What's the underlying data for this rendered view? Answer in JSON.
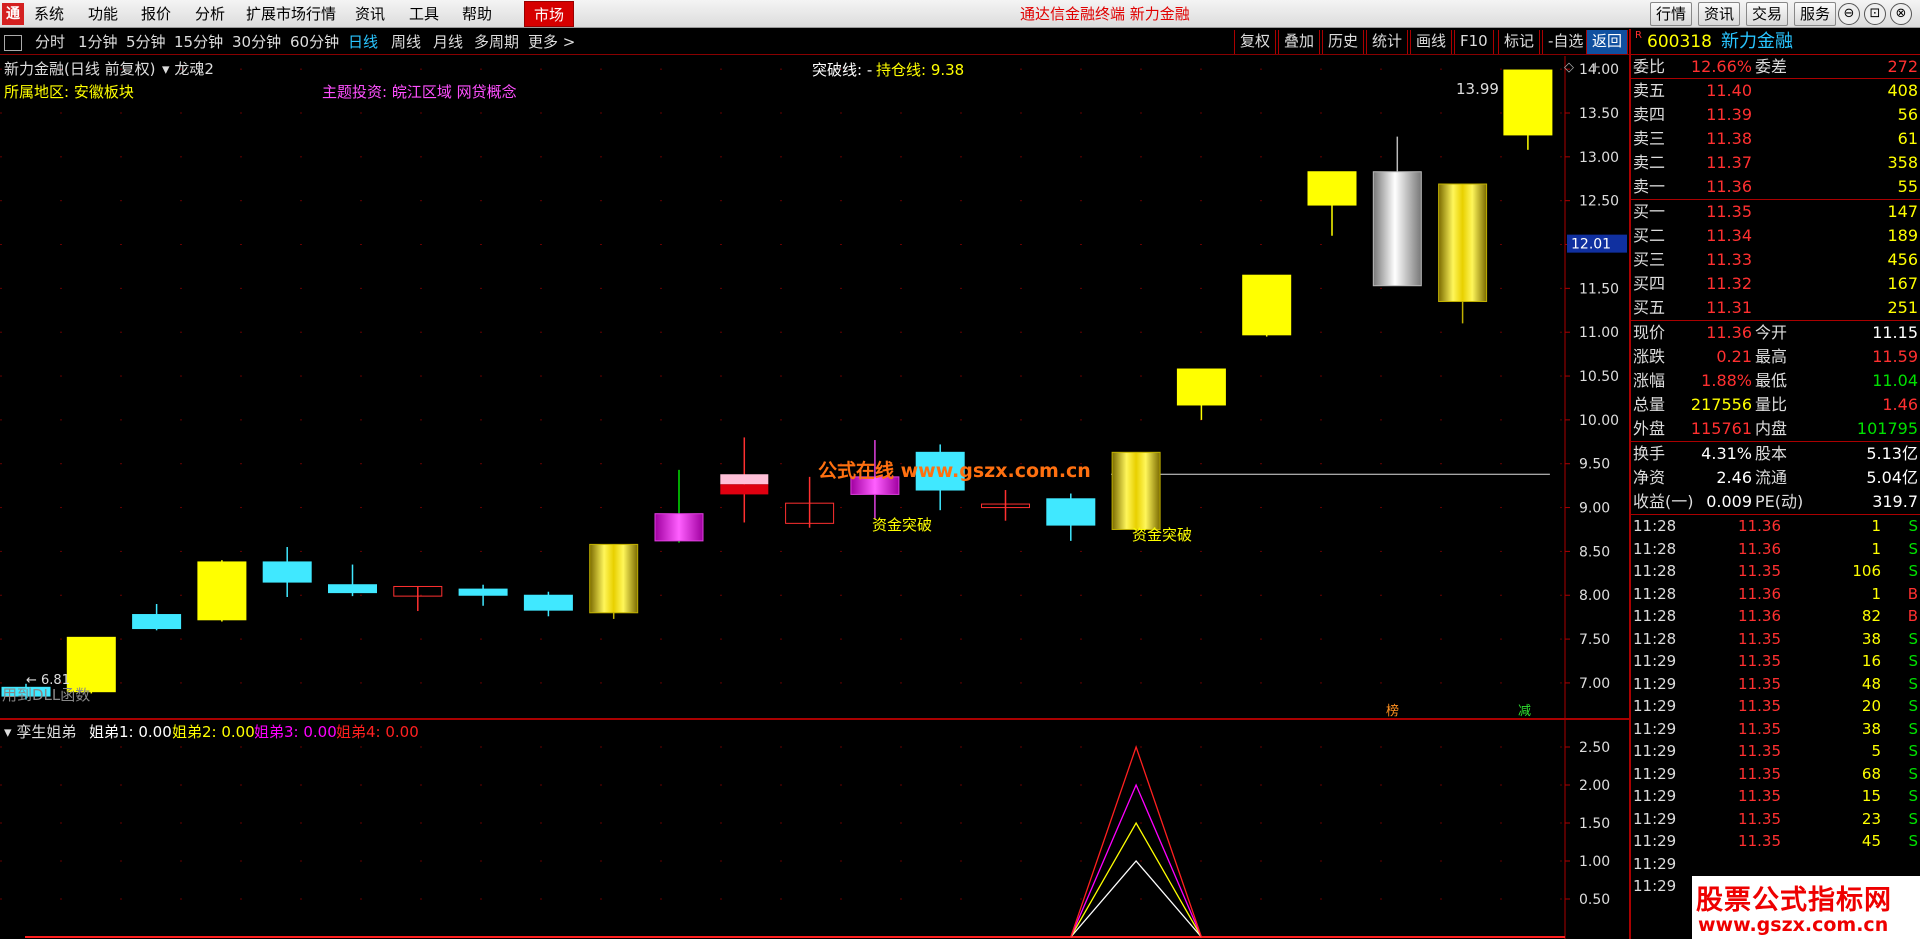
{
  "menubar": {
    "logo": "通",
    "items": [
      "系统",
      "功能",
      "报价",
      "分析",
      "扩展市场行情",
      "资讯",
      "工具",
      "帮助"
    ],
    "market_button": "市场",
    "center_title": "通达信金融终端  新力金融",
    "right_buttons": [
      "行情",
      "资讯",
      "交易",
      "服务"
    ],
    "window_controls": [
      "⊖",
      "⊡",
      "⊗"
    ]
  },
  "toolbar": {
    "periods": [
      "分时",
      "1分钟",
      "5分钟",
      "15分钟",
      "30分钟",
      "60分钟",
      "日线",
      "周线",
      "月线",
      "多周期",
      "更多 >"
    ],
    "active_period": "日线",
    "tools": [
      "复权",
      "叠加",
      "历史",
      "统计",
      "画线",
      "F10",
      "标记",
      "-自选",
      "返回"
    ]
  },
  "main_chart": {
    "title": "新力金融(日线 前复权)",
    "indicator": "龙魂2",
    "region_label": "所属地区: 安徽板块",
    "theme_label": "主题投资: 皖江区域 网贷概念",
    "breakout_label": "突破线: -",
    "hold_label": "持仓线: 9.38",
    "high_label": "13.99",
    "low_label": "← 6.81",
    "dll_label": "用到DLL函数",
    "watermark": "公式在线  www.gszx.com.cn",
    "price_tag": "12.01",
    "signal_labels": [
      "资金突破",
      "资金突破"
    ],
    "badges": [
      "榜",
      "减"
    ],
    "axis": [
      "14.00",
      "13.50",
      "13.00",
      "12.50",
      "12.00",
      "11.50",
      "11.00",
      "10.50",
      "10.00",
      "9.50",
      "9.00",
      "8.50",
      "8.00",
      "7.50",
      "7.00"
    ]
  },
  "chart_data": {
    "type": "candlestick",
    "ylim": [
      6.6,
      14.15
    ],
    "hold_line": 9.38,
    "candles": [
      {
        "o": 6.95,
        "c": 6.85,
        "h": 6.99,
        "l": 6.81,
        "color": "cyan"
      },
      {
        "o": 6.9,
        "c": 7.52,
        "h": 7.52,
        "l": 6.88,
        "color": "yellow"
      },
      {
        "o": 7.62,
        "c": 7.78,
        "h": 7.9,
        "l": 7.6,
        "color": "cyan"
      },
      {
        "o": 7.72,
        "c": 8.38,
        "h": 8.4,
        "l": 7.7,
        "color": "yellow"
      },
      {
        "o": 8.15,
        "c": 8.38,
        "h": 8.55,
        "l": 7.98,
        "color": "cyan"
      },
      {
        "o": 8.03,
        "c": 8.12,
        "h": 8.35,
        "l": 7.99,
        "color": "cyan"
      },
      {
        "o": 8.1,
        "c": 7.99,
        "h": 8.1,
        "l": 7.82,
        "color": "red-hollow"
      },
      {
        "o": 8.0,
        "c": 8.07,
        "h": 8.12,
        "l": 7.88,
        "color": "cyan"
      },
      {
        "o": 7.83,
        "c": 8.0,
        "h": 8.04,
        "l": 7.76,
        "color": "cyan"
      },
      {
        "o": 7.8,
        "c": 8.58,
        "h": 8.58,
        "l": 7.73,
        "color": "gold-stripe"
      },
      {
        "o": 8.62,
        "c": 8.93,
        "h": 9.43,
        "l": 8.6,
        "color": "magenta"
      },
      {
        "o": 9.15,
        "c": 9.38,
        "h": 9.8,
        "l": 8.83,
        "color": "pink-red"
      },
      {
        "o": 9.05,
        "c": 8.82,
        "h": 9.35,
        "l": 8.77,
        "color": "red-hollow"
      },
      {
        "o": 9.15,
        "c": 9.35,
        "h": 9.77,
        "l": 8.87,
        "color": "magenta"
      },
      {
        "o": 9.2,
        "c": 9.63,
        "h": 9.72,
        "l": 8.97,
        "color": "cyan"
      },
      {
        "o": 9.04,
        "c": 9.0,
        "h": 9.2,
        "l": 8.85,
        "color": "red-hollow"
      },
      {
        "o": 8.8,
        "c": 9.1,
        "h": 9.16,
        "l": 8.62,
        "color": "cyan"
      },
      {
        "o": 8.75,
        "c": 9.63,
        "h": 9.63,
        "l": 8.72,
        "color": "gold-stripe"
      },
      {
        "o": 10.17,
        "c": 10.58,
        "h": 10.58,
        "l": 10.0,
        "color": "yellow"
      },
      {
        "o": 10.97,
        "c": 11.65,
        "h": 11.65,
        "l": 10.95,
        "color": "yellow"
      },
      {
        "o": 12.45,
        "c": 12.83,
        "h": 12.83,
        "l": 12.1,
        "color": "yellow"
      },
      {
        "o": 11.53,
        "c": 12.83,
        "h": 13.23,
        "l": 11.53,
        "color": "silver"
      },
      {
        "o": 11.35,
        "c": 12.69,
        "h": 12.69,
        "l": 11.1,
        "color": "gold-stripe"
      },
      {
        "o": 13.25,
        "c": 13.99,
        "h": 13.99,
        "l": 13.08,
        "color": "yellow"
      }
    ],
    "sub": {
      "ylim": [
        0,
        2.75
      ],
      "peak_index": 17,
      "peaks": [
        1.0,
        1.5,
        2.0,
        2.5
      ],
      "colors": [
        "#ffffff",
        "#ffff00",
        "#ff00ff",
        "#ff2020"
      ],
      "axis": [
        "2.50",
        "2.00",
        "1.50",
        "1.00",
        "0.50"
      ]
    }
  },
  "sub_chart": {
    "title": "孪生姐弟",
    "legend": [
      {
        "label": "姐弟1: 0.00",
        "color": "#ffffff"
      },
      {
        "label": "姐弟2: 0.00",
        "color": "#ffff00"
      },
      {
        "label": "姐弟3: 0.00",
        "color": "#ff00ff"
      },
      {
        "label": "姐弟4: 0.00",
        "color": "#ff2020"
      }
    ]
  },
  "quote": {
    "code": "600318",
    "name": "新力金融",
    "r_flag": "R",
    "weibi": {
      "l1": "委比",
      "v1": "12.66%",
      "l2": "委差",
      "v2": "272"
    },
    "sells": [
      {
        "label": "卖五",
        "price": "11.40",
        "vol": "408"
      },
      {
        "label": "卖四",
        "price": "11.39",
        "vol": "56"
      },
      {
        "label": "卖三",
        "price": "11.38",
        "vol": "61"
      },
      {
        "label": "卖二",
        "price": "11.37",
        "vol": "358"
      },
      {
        "label": "卖一",
        "price": "11.36",
        "vol": "55"
      }
    ],
    "buys": [
      {
        "label": "买一",
        "price": "11.35",
        "vol": "147"
      },
      {
        "label": "买二",
        "price": "11.34",
        "vol": "189"
      },
      {
        "label": "买三",
        "price": "11.33",
        "vol": "456"
      },
      {
        "label": "买四",
        "price": "11.32",
        "vol": "167"
      },
      {
        "label": "买五",
        "price": "11.31",
        "vol": "251"
      }
    ],
    "stats1": [
      {
        "l1": "现价",
        "v1": "11.36",
        "c1": "#ff3030",
        "l2": "今开",
        "v2": "11.15",
        "c2": "#ffffff"
      },
      {
        "l1": "涨跌",
        "v1": "0.21",
        "c1": "#ff3030",
        "l2": "最高",
        "v2": "11.59",
        "c2": "#ff3030"
      },
      {
        "l1": "涨幅",
        "v1": "1.88%",
        "c1": "#ff3030",
        "l2": "最低",
        "v2": "11.04",
        "c2": "#00e000"
      },
      {
        "l1": "总量",
        "v1": "217556",
        "c1": "#ffff00",
        "l2": "量比",
        "v2": "1.46",
        "c2": "#ff3030"
      },
      {
        "l1": "外盘",
        "v1": "115761",
        "c1": "#ff3030",
        "l2": "内盘",
        "v2": "101795",
        "c2": "#00e000"
      }
    ],
    "stats2": [
      {
        "l1": "换手",
        "v1": "4.31%",
        "l2": "股本",
        "v2": "5.13亿"
      },
      {
        "l1": "净资",
        "v1": "2.46",
        "l2": "流通",
        "v2": "5.04亿"
      },
      {
        "l1": "收益(一)",
        "v1": "0.009",
        "l2": "PE(动)",
        "v2": "319.7"
      }
    ],
    "ticks": [
      {
        "t": "11:28",
        "p": "11.36",
        "v": "1",
        "s": "S"
      },
      {
        "t": "11:28",
        "p": "11.36",
        "v": "1",
        "s": "S"
      },
      {
        "t": "11:28",
        "p": "11.35",
        "v": "106",
        "s": "S"
      },
      {
        "t": "11:28",
        "p": "11.36",
        "v": "1",
        "s": "B"
      },
      {
        "t": "11:28",
        "p": "11.36",
        "v": "82",
        "s": "B"
      },
      {
        "t": "11:28",
        "p": "11.35",
        "v": "38",
        "s": "S"
      },
      {
        "t": "11:29",
        "p": "11.35",
        "v": "16",
        "s": "S"
      },
      {
        "t": "11:29",
        "p": "11.35",
        "v": "48",
        "s": "S"
      },
      {
        "t": "11:29",
        "p": "11.35",
        "v": "20",
        "s": "S"
      },
      {
        "t": "11:29",
        "p": "11.35",
        "v": "38",
        "s": "S"
      },
      {
        "t": "11:29",
        "p": "11.35",
        "v": "5",
        "s": "S"
      },
      {
        "t": "11:29",
        "p": "11.35",
        "v": "68",
        "s": "S"
      },
      {
        "t": "11:29",
        "p": "11.35",
        "v": "15",
        "s": "S"
      },
      {
        "t": "11:29",
        "p": "11.35",
        "v": "23",
        "s": "S"
      },
      {
        "t": "11:29",
        "p": "11.35",
        "v": "45",
        "s": "S"
      },
      {
        "t": "11:29",
        "p": "",
        "v": "",
        "s": ""
      },
      {
        "t": "11:29",
        "p": "",
        "v": "",
        "s": ""
      }
    ]
  },
  "watermark_box": {
    "line1": "股票公式指标网",
    "line2": "www.gszx.com.cn"
  }
}
